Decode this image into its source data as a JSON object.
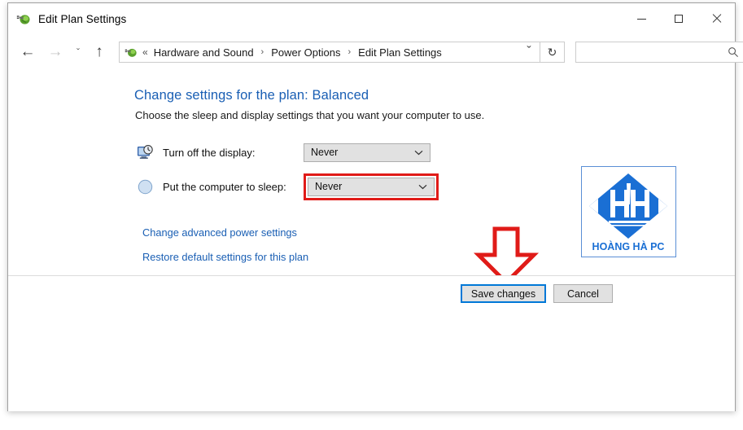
{
  "window": {
    "title": "Edit Plan Settings",
    "title_icon": "power-plug-icon",
    "controls": {
      "minimize": "minimize-icon",
      "maximize": "maximize-icon",
      "close": "close-icon"
    }
  },
  "nav": {
    "back": "←",
    "forward": "→",
    "recent": "ˇ",
    "up": "↑",
    "dropdown": "ˇ",
    "refresh": "↻",
    "breadcrumb_icon": "power-plug-icon",
    "breadcrumb_overflow": "«",
    "breadcrumbs": [
      "Hardware and Sound",
      "Power Options",
      "Edit Plan Settings"
    ],
    "separator": "›"
  },
  "search": {
    "value": "",
    "placeholder": "",
    "icon": "search-icon"
  },
  "main": {
    "heading": "Change settings for the plan: Balanced",
    "subheading": "Choose the sleep and display settings that you want your computer to use.",
    "settings": [
      {
        "icon": "monitor-clock-icon",
        "label": "Turn off the display:",
        "value": "Never",
        "highlighted": false
      },
      {
        "icon": "sleep-moon-icon",
        "label": "Put the computer to sleep:",
        "value": "Never",
        "highlighted": true
      }
    ],
    "links": [
      "Change advanced power settings",
      "Restore default settings for this plan"
    ]
  },
  "logo": {
    "brand_text": "HOÀNG HÀ PC",
    "monogram": "HH",
    "color": "#1a6fd4",
    "border_color": "#5a8fd6"
  },
  "footer": {
    "save_label": "Save changes",
    "cancel_label": "Cancel"
  },
  "annotations": {
    "highlight_color": "#e01b18",
    "arrow_color": "#e01b18",
    "focus_border_color": "#0078d7"
  }
}
